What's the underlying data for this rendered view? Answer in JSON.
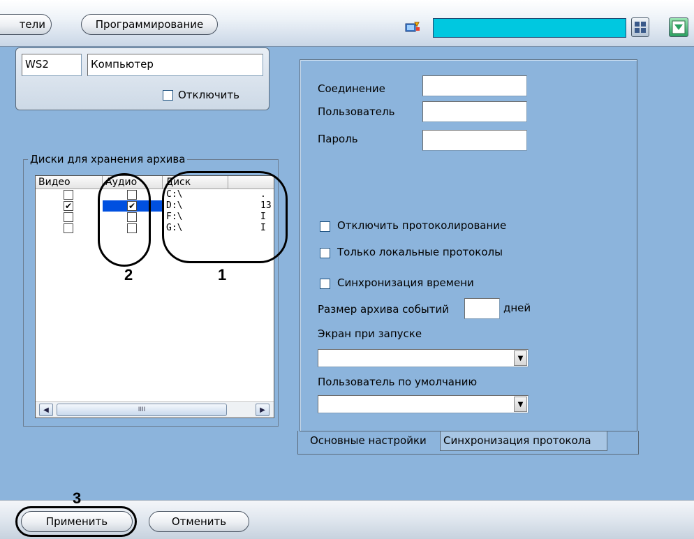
{
  "toolbar": {
    "tab_users_label": "тели",
    "tab_programming_label": "Программирование"
  },
  "colors": {
    "accent": "#00c8e0",
    "background": "#8cb4dc",
    "selected_row": "#0050e0"
  },
  "workstation": {
    "id": "WS2",
    "name": "Компьютер",
    "disable_label": "Отключить"
  },
  "disks": {
    "group_title": "Диски для хранения архива",
    "columns": [
      "Видео",
      "Аудио",
      "Диск",
      ""
    ],
    "rows": [
      {
        "video": false,
        "audio": false,
        "disk": "C:\\",
        "extra": "."
      },
      {
        "video": true,
        "audio": true,
        "disk": "D:\\",
        "extra": "13"
      },
      {
        "video": false,
        "audio": false,
        "disk": "F:\\",
        "extra": "I"
      },
      {
        "video": false,
        "audio": false,
        "disk": "G:\\",
        "extra": "I"
      }
    ],
    "scroll_grip": "IIII"
  },
  "settings": {
    "connection_label": "Соединение",
    "user_label": "Пользователь",
    "password_label": "Пароль",
    "disable_logging_label": "Отключить протоколирование",
    "local_logs_label": "Только локальные протоколы",
    "time_sync_label": "Синхронизация времени",
    "event_archive_label": "Размер архива событий",
    "days_label": "дней",
    "startup_screen_label": "Экран при запуске",
    "default_user_label": "Пользователь по умолчанию"
  },
  "tabs": {
    "main_label": "Основные настройки",
    "sync_label": "Синхронизация протокола"
  },
  "footer": {
    "apply_label": "Применить",
    "cancel_label": "Отменить"
  },
  "annotations": {
    "n1": "1",
    "n2": "2",
    "n3": "3"
  }
}
